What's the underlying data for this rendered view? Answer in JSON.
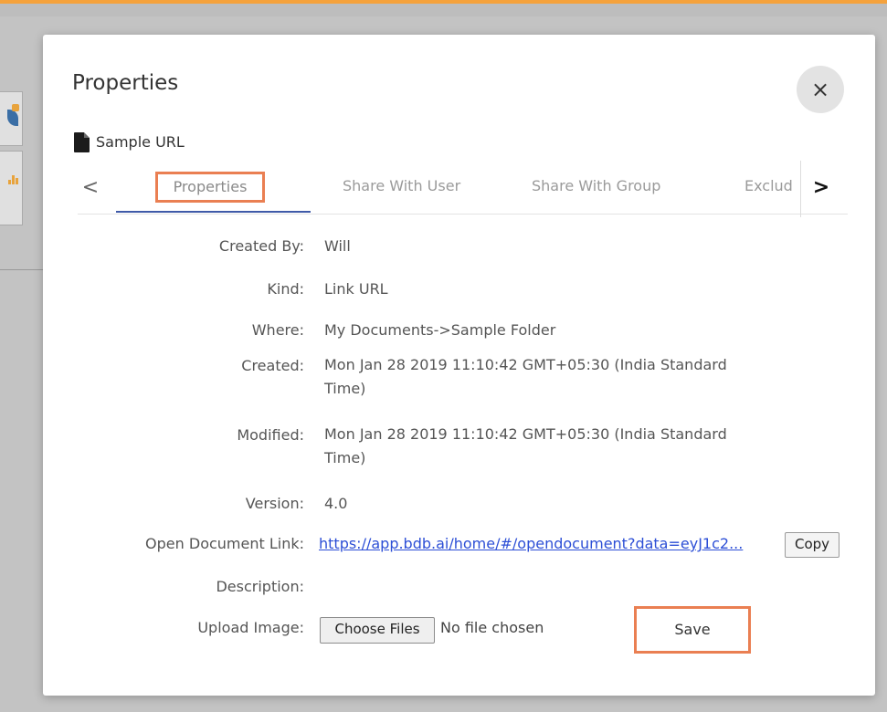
{
  "dialog": {
    "title": "Properties",
    "close_glyph": "×",
    "document_name": "Sample URL",
    "document_icon": "file-icon"
  },
  "tabs": {
    "prev_glyph": "<",
    "next_glyph": ">",
    "items": [
      {
        "label": "Properties",
        "active": true
      },
      {
        "label": "Share With User",
        "active": false
      },
      {
        "label": "Share With Group",
        "active": false
      },
      {
        "label": "Exclud",
        "active": false
      }
    ]
  },
  "fields": {
    "created_by": {
      "label": "Created By:",
      "value": "Will"
    },
    "kind": {
      "label": "Kind:",
      "value": "Link URL"
    },
    "where": {
      "label": "Where:",
      "value": "My Documents->Sample Folder"
    },
    "created": {
      "label": "Created:",
      "value": "Mon Jan 28 2019 11:10:42 GMT+05:30 (India Standard Time)"
    },
    "modified": {
      "label": "Modified:",
      "value": "Mon Jan 28 2019 11:10:42 GMT+05:30 (India Standard Time)"
    },
    "version": {
      "label": "Version:",
      "value": "4.0"
    },
    "open_link": {
      "label": "Open Document Link:",
      "value": "https://app.bdb.ai/home/#/opendocument?data=eyJ1c2..."
    },
    "description": {
      "label": "Description:"
    },
    "upload_image": {
      "label": "Upload Image:"
    }
  },
  "buttons": {
    "copy": "Copy",
    "choose_files": "Choose Files",
    "no_file": "No file chosen",
    "save": "Save"
  },
  "colors": {
    "highlight": "#ea7f52",
    "tab_underline": "#3f5aa8",
    "link": "#2d4fd6",
    "top_accent": "#f5a23c"
  }
}
